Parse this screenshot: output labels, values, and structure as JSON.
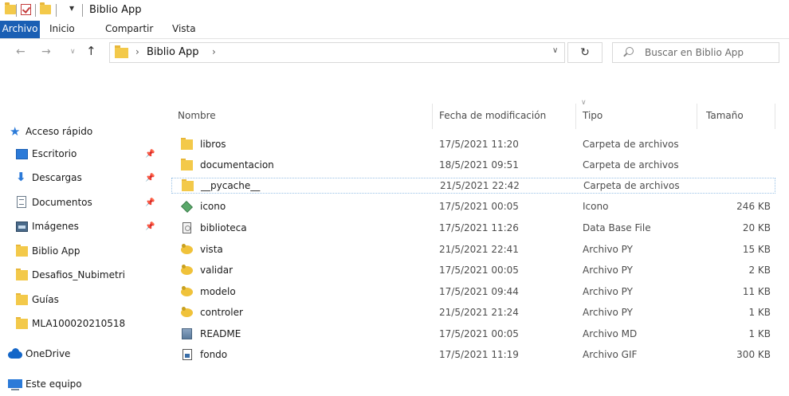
{
  "window": {
    "title": "Biblio App"
  },
  "ribbon": {
    "tabs": [
      "Archivo",
      "Inicio",
      "Compartir",
      "Vista"
    ]
  },
  "address": {
    "path": "Biblio App",
    "search_placeholder": "Buscar en Biblio App"
  },
  "sidebar": {
    "items": [
      {
        "label": "Acceso rápido",
        "icon": "star-icon"
      },
      {
        "label": "Escritorio",
        "icon": "desktop-icon",
        "pinned": true
      },
      {
        "label": "Descargas",
        "icon": "download-icon",
        "pinned": true
      },
      {
        "label": "Documentos",
        "icon": "documents-icon",
        "pinned": true
      },
      {
        "label": "Imágenes",
        "icon": "pictures-icon",
        "pinned": true
      },
      {
        "label": "Biblio App",
        "icon": "folder-icon"
      },
      {
        "label": "Desafios_Nubimetri",
        "icon": "folder-icon"
      },
      {
        "label": "Guías",
        "icon": "folder-icon"
      },
      {
        "label": "MLA100020210518",
        "icon": "folder-icon"
      },
      {
        "label": "OneDrive",
        "icon": "cloud-icon"
      },
      {
        "label": "Este equipo",
        "icon": "computer-icon"
      }
    ]
  },
  "columns": {
    "name": "Nombre",
    "date": "Fecha de modificación",
    "type": "Tipo",
    "size": "Tamaño"
  },
  "files": [
    {
      "name": "libros",
      "date": "17/5/2021 11:20",
      "type": "Carpeta de archivos",
      "size": "",
      "icon": "folder-icon"
    },
    {
      "name": "documentacion",
      "date": "18/5/2021 09:51",
      "type": "Carpeta de archivos",
      "size": "",
      "icon": "folder-icon"
    },
    {
      "name": "__pycache__",
      "date": "21/5/2021 22:42",
      "type": "Carpeta de archivos",
      "size": "",
      "icon": "folder-icon",
      "selected": true
    },
    {
      "name": "icono",
      "date": "17/5/2021 00:05",
      "type": "Icono",
      "size": "246 KB",
      "icon": "ico-file-icon"
    },
    {
      "name": "biblioteca",
      "date": "17/5/2021 11:26",
      "type": "Data Base File",
      "size": "20 KB",
      "icon": "database-file-icon"
    },
    {
      "name": "vista",
      "date": "21/5/2021 22:41",
      "type": "Archivo PY",
      "size": "15 KB",
      "icon": "python-file-icon"
    },
    {
      "name": "validar",
      "date": "17/5/2021 00:05",
      "type": "Archivo PY",
      "size": "2 KB",
      "icon": "python-file-icon"
    },
    {
      "name": "modelo",
      "date": "17/5/2021 09:44",
      "type": "Archivo PY",
      "size": "11 KB",
      "icon": "python-file-icon"
    },
    {
      "name": "controler",
      "date": "21/5/2021 21:24",
      "type": "Archivo PY",
      "size": "1 KB",
      "icon": "python-file-icon"
    },
    {
      "name": "README",
      "date": "17/5/2021 00:05",
      "type": "Archivo MD",
      "size": "1 KB",
      "icon": "markdown-file-icon"
    },
    {
      "name": "fondo",
      "date": "17/5/2021 11:19",
      "type": "Archivo GIF",
      "size": "300 KB",
      "icon": "gif-file-icon"
    }
  ],
  "colors": {
    "accent": "#1a5fb4",
    "folder": "#f3c94a",
    "selection_border": "#99c1e6"
  }
}
